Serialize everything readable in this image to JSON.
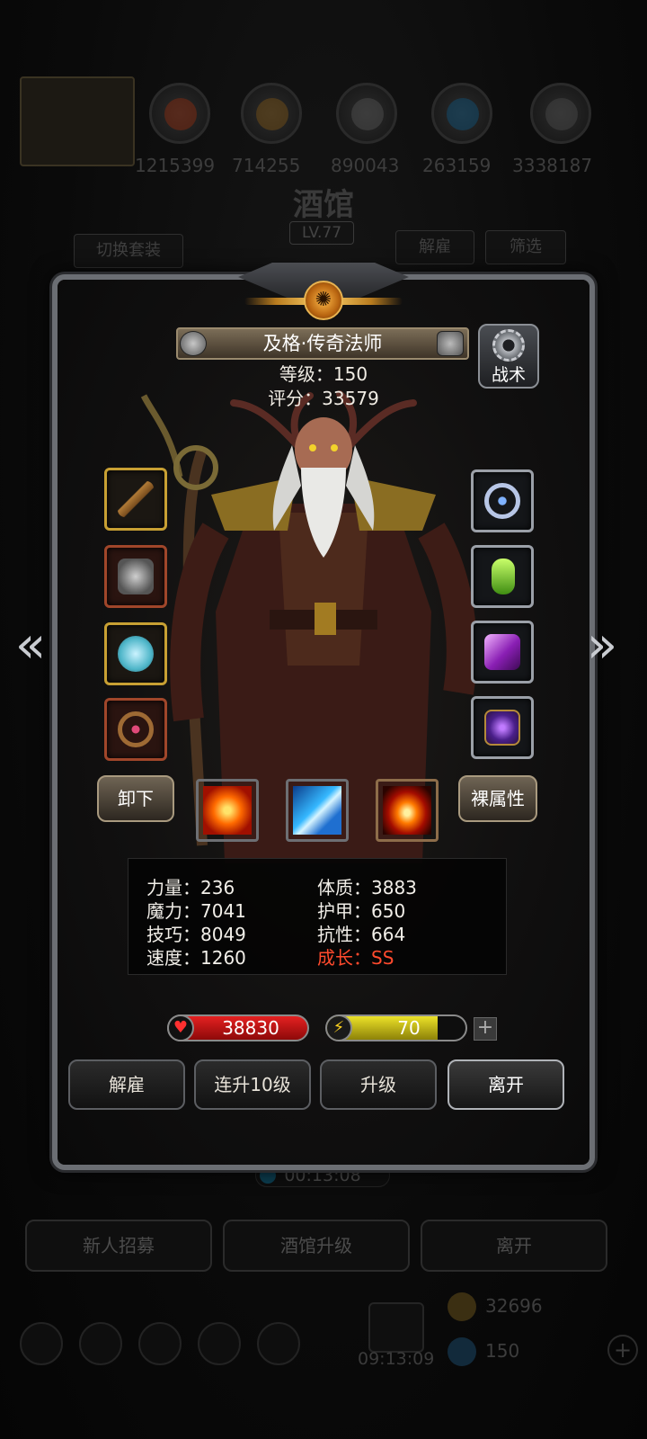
{
  "background": {
    "resource_counts": [
      "1215399",
      "714255",
      "890043",
      "263159",
      "3338187"
    ],
    "tavern_title": "酒馆",
    "tavern_level": "LV.77",
    "switch_outfit_label": "切换套装",
    "dismiss_tab_label": "解雇",
    "filter_tab_label": "筛选",
    "timer": "00:13:08",
    "buttons": [
      "新人招募",
      "酒馆升级",
      "离开"
    ],
    "bottom_timer": "09:13:09",
    "gold": "32696",
    "gems": "150"
  },
  "hero": {
    "name": "及格·传奇法师",
    "level_label": "等级：150",
    "score_label": "评分：33579",
    "tactics_label": "战术",
    "unequip_label": "卸下",
    "base_attr_label": "裸属性"
  },
  "stats": {
    "strength": "力量：236",
    "magic": "魔力：7041",
    "skill": "技巧：8049",
    "speed": "速度：1260",
    "constitution": "体质：3883",
    "armor": "护甲：650",
    "resistance": "抗性：664",
    "growth": "成长：SS"
  },
  "bars": {
    "hp": "38830",
    "energy": "70",
    "energy_fill": 0.8,
    "add_symbol": "+"
  },
  "actions": {
    "dismiss": "解雇",
    "level_up_10": "连升10级",
    "upgrade": "升级",
    "leave": "离开"
  },
  "icons": {
    "left_equipment": [
      "staff-icon",
      "chest-armor-icon",
      "gem-ring-icon",
      "bracelet-icon"
    ],
    "right_equipment": [
      "crown-ring-icon",
      "green-crystal-icon",
      "purple-gem-icon",
      "purple-tome-icon"
    ],
    "skills": [
      "fire-burst-icon",
      "ice-shard-icon",
      "flame-icon"
    ]
  },
  "colors": {
    "growth_red": "#ff4a2d",
    "hp_red": "#e52121",
    "energy_yellow": "#ece229",
    "gold_frame": "#c8a033"
  }
}
